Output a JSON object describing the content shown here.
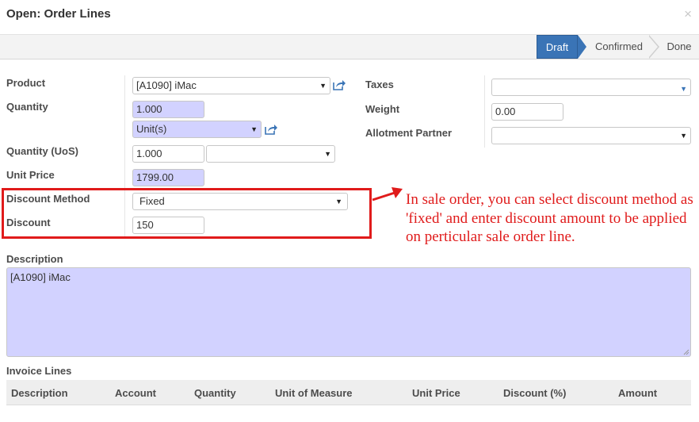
{
  "dialog": {
    "title": "Open: Order Lines",
    "close_glyph": "×"
  },
  "status": {
    "stages": [
      "Draft",
      "Confirmed",
      "Done"
    ],
    "active": "Draft",
    "active_color": "#3a74b6"
  },
  "form": {
    "product": {
      "label": "Product",
      "value": "[A1090] iMac"
    },
    "quantity": {
      "label": "Quantity",
      "value": "1.000",
      "uom": "Unit(s)"
    },
    "quantity_uos": {
      "label": "Quantity (UoS)",
      "value": "1.000",
      "uos": ""
    },
    "unit_price": {
      "label": "Unit Price",
      "value": "1799.00"
    },
    "discount_method": {
      "label": "Discount Method",
      "value": "Fixed"
    },
    "discount": {
      "label": "Discount",
      "value": "150"
    },
    "taxes": {
      "label": "Taxes",
      "value": ""
    },
    "weight": {
      "label": "Weight",
      "value": "0.00"
    },
    "allotment_partner": {
      "label": "Allotment Partner",
      "value": ""
    },
    "description": {
      "label": "Description",
      "value": "[A1090] iMac"
    }
  },
  "annotation": {
    "text": "In sale order, you can select discount method as 'fixed' and enter discount amount to be applied on perticular sale order line.",
    "color": "#e01b1b"
  },
  "invoice_lines": {
    "label": "Invoice Lines",
    "columns": [
      "Description",
      "Account",
      "Quantity",
      "Unit of Measure",
      "Unit Price",
      "Discount (%)",
      "Amount"
    ]
  },
  "colors": {
    "required_field_bg": "#d2d2ff",
    "accent": "#3a74b6"
  },
  "icons": {
    "external_link": "external-link-icon",
    "dropdown": "caret-down-icon"
  }
}
